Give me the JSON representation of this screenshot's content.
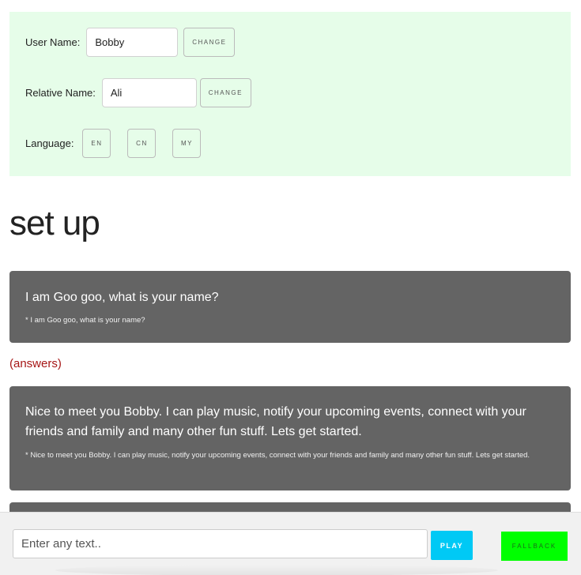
{
  "settings": {
    "user_name_label": "User Name:",
    "user_name_value": "Bobby",
    "user_change_label": "CHANGE",
    "relative_name_label": "Relative Name:",
    "relative_name_value": "Ali",
    "relative_change_label": "CHANGE",
    "language_label": "Language:",
    "languages": [
      "EN",
      "CN",
      "MY"
    ],
    "background_color": "#e6fde9"
  },
  "section_title": "set up",
  "messages": [
    {
      "text": "I am Goo goo, what is your name?",
      "subtext": "* I am Goo goo, what is your name?"
    },
    {
      "text": "Nice to meet you Bobby. I can play music, notify your upcoming events, connect with your friends and family and many other fun stuff. Lets get started.",
      "subtext": "* Nice to meet you Bobby. I can play music, notify your upcoming events, connect with your friends and family and many other fun stuff. Lets get started."
    }
  ],
  "answers_link": "(answers)",
  "chat": {
    "placeholder": "Enter any text..",
    "play_label": "PLAY",
    "fallback_label": "FALLBACK"
  },
  "colors": {
    "card_bg": "#646464",
    "answers_link": "#a61616",
    "play_button": "#00c9f5",
    "fallback_button": "#00ff00"
  }
}
